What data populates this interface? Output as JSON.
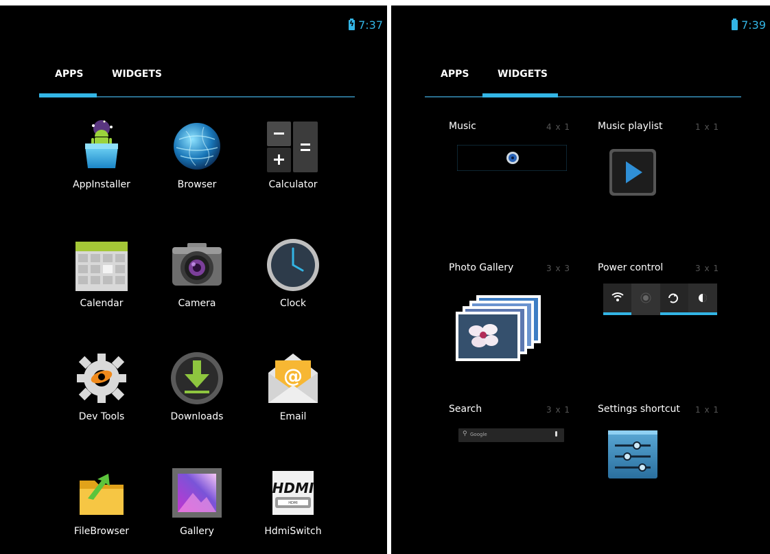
{
  "left_screen": {
    "status": {
      "time": "7:37",
      "battery_icon": "battery-charging-icon"
    },
    "tabs": [
      {
        "label": "APPS",
        "selected": true
      },
      {
        "label": "WIDGETS",
        "selected": false
      }
    ],
    "apps": [
      {
        "label": "AppInstaller",
        "icon": "app-installer-icon"
      },
      {
        "label": "Browser",
        "icon": "browser-globe-icon"
      },
      {
        "label": "Calculator",
        "icon": "calculator-icon"
      },
      {
        "label": "Calendar",
        "icon": "calendar-icon"
      },
      {
        "label": "Camera",
        "icon": "camera-icon"
      },
      {
        "label": "Clock",
        "icon": "clock-icon"
      },
      {
        "label": "Dev Tools",
        "icon": "dev-tools-gear-icon"
      },
      {
        "label": "Downloads",
        "icon": "downloads-icon"
      },
      {
        "label": "Email",
        "icon": "email-icon"
      },
      {
        "label": "FileBrowser",
        "icon": "file-browser-folder-icon"
      },
      {
        "label": "Gallery",
        "icon": "gallery-icon"
      },
      {
        "label": "HdmiSwitch",
        "icon": "hdmi-switch-icon",
        "icon_text": "HDMI",
        "icon_subtext": "HDMI"
      }
    ]
  },
  "right_screen": {
    "status": {
      "time": "7:39",
      "battery_icon": "battery-icon"
    },
    "tabs": [
      {
        "label": "APPS",
        "selected": false
      },
      {
        "label": "WIDGETS",
        "selected": true
      }
    ],
    "widgets": [
      {
        "name": "Music",
        "size": "4 x 1",
        "preview": "music-widget-preview"
      },
      {
        "name": "Music playlist",
        "size": "1 x 1",
        "preview": "play-icon"
      },
      {
        "name": "Photo Gallery",
        "size": "3 x 3",
        "preview": "photo-stack-icon"
      },
      {
        "name": "Power control",
        "size": "3 x 1",
        "preview": "power-control-bar"
      },
      {
        "name": "Search",
        "size": "3 x 1",
        "preview": "search-bar-preview",
        "search_hint": "Google"
      },
      {
        "name": "Settings shortcut",
        "size": "1 x 1",
        "preview": "settings-sliders-icon"
      }
    ]
  },
  "colors": {
    "accent": "#33b5e5",
    "tab_line": "#2a6f8f",
    "background": "#000000",
    "dim_text": "#555555"
  }
}
